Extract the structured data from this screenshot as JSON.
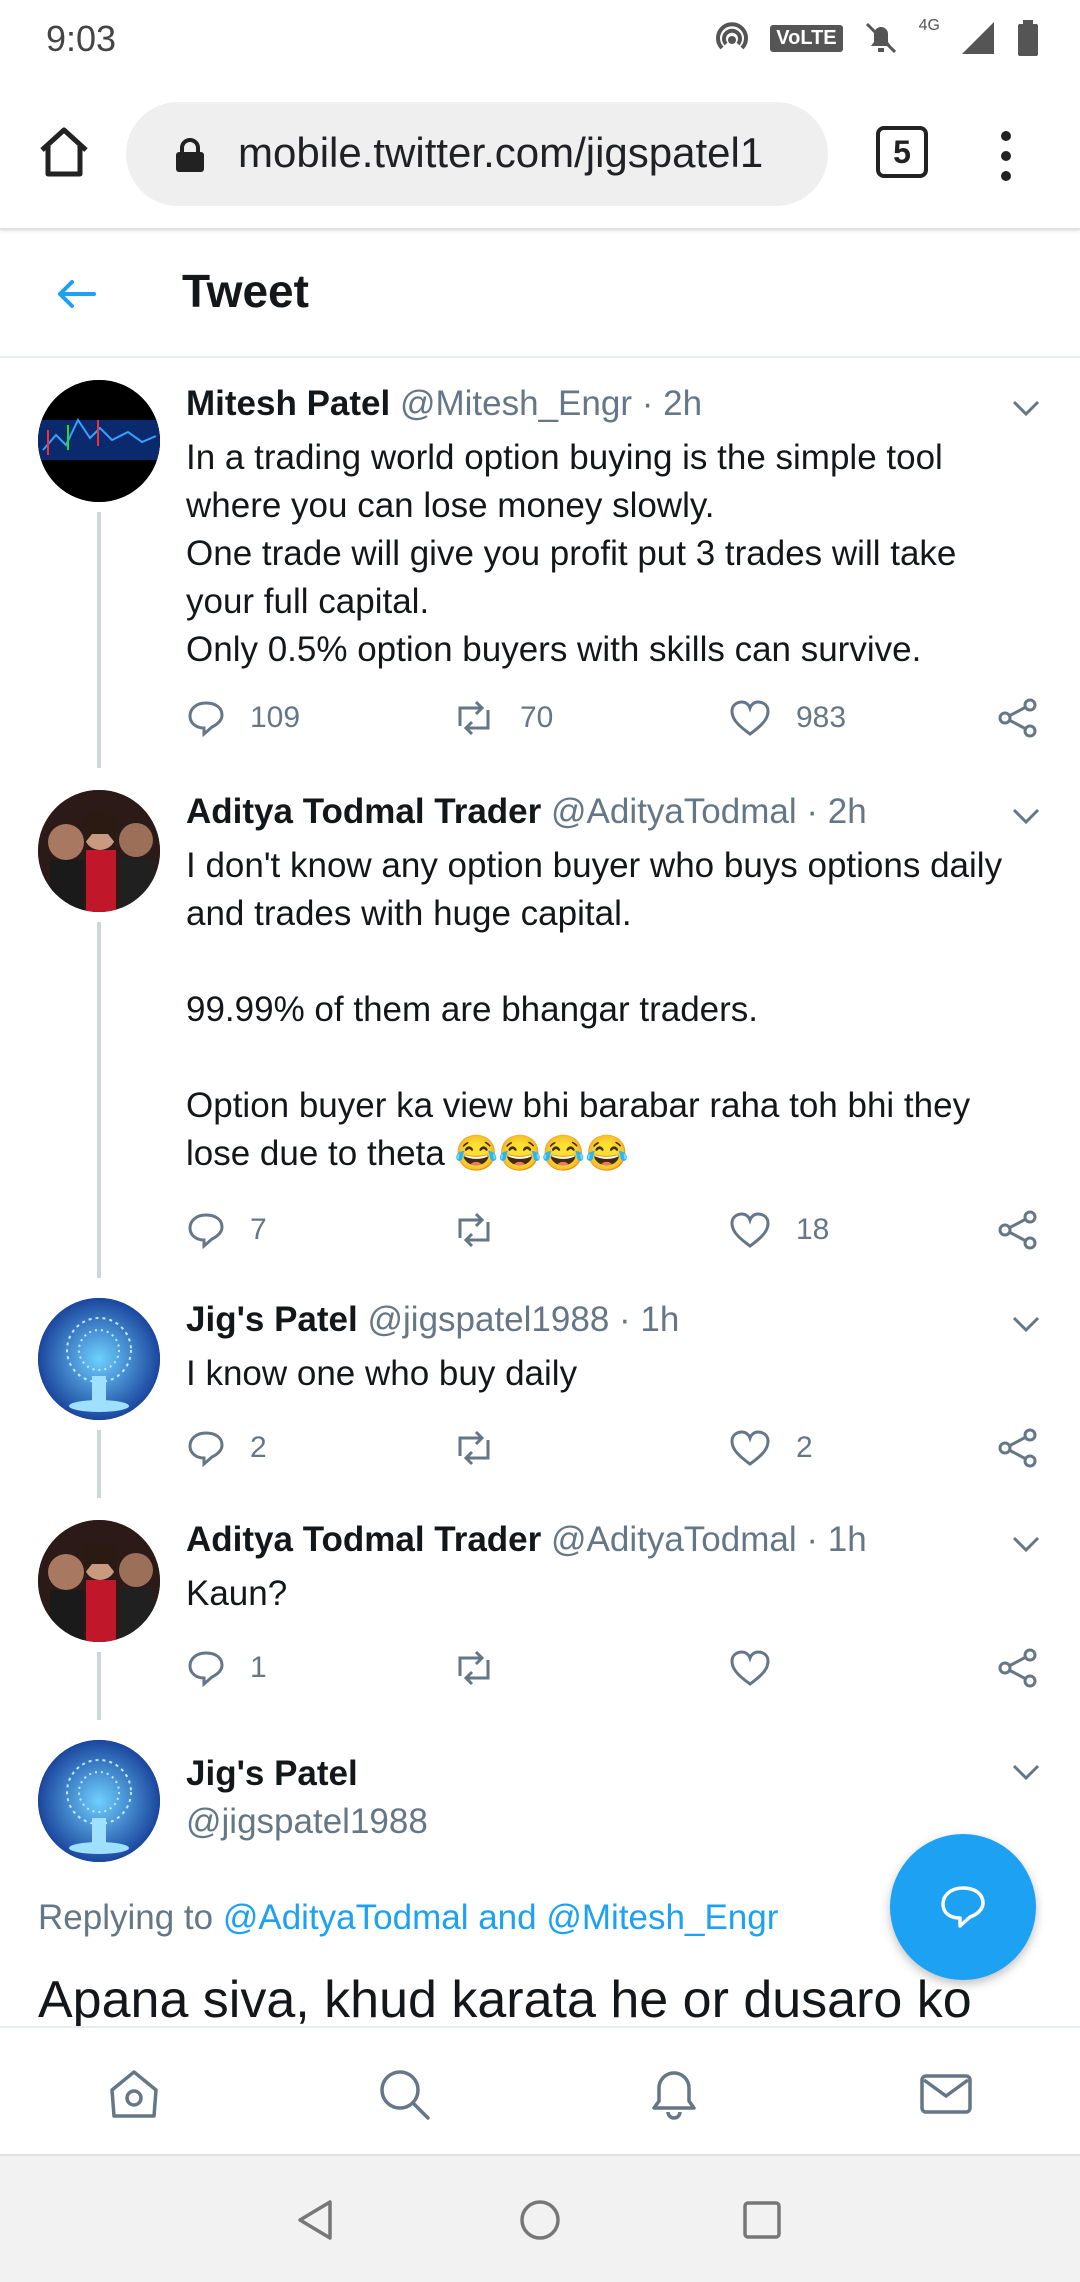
{
  "status_bar": {
    "time": "9:03",
    "network_label": "VoLTE",
    "signal_label": "4G"
  },
  "browser": {
    "url": "mobile.twitter.com/jigspatel1",
    "tab_count": "5"
  },
  "header": {
    "title": "Tweet"
  },
  "tweets": [
    {
      "name": "Mitesh Patel",
      "handle": "@Mitesh_Engr",
      "time": "2h",
      "text": "In a trading world option buying is the simple tool\nwhere you can lose money slowly.\nOne trade will give you profit put 3 trades will take\nyour full capital.\nOnly 0.5% option buyers with skills can survive.",
      "replies": "109",
      "retweets": "70",
      "likes": "983"
    },
    {
      "name": "Aditya Todmal Trader",
      "handle": "@AdityaTodmal",
      "time": "2h",
      "text": "I don't know any option buyer who buys options daily\nand trades with huge capital.\n\n99.99% of them are bhangar traders.\n\nOption buyer ka view bhi barabar raha toh bhi they\nlose due to theta 😂😂😂😂",
      "replies": "7",
      "retweets": "",
      "likes": "18"
    },
    {
      "name": "Jig's Patel",
      "handle": "@jigspatel1988",
      "time": "1h",
      "text": "I know one who buy daily",
      "replies": "2",
      "retweets": "",
      "likes": "2"
    },
    {
      "name": "Aditya Todmal Trader",
      "handle": "@AdityaTodmal",
      "time": "1h",
      "text": "Kaun?",
      "replies": "1",
      "retweets": "",
      "likes": ""
    }
  ],
  "focused_tweet": {
    "name": "Jig's Patel",
    "handle": "@jigspatel1988",
    "replying_prefix": "Replying to",
    "replying_to_1": "@AdityaTodmal",
    "replying_and": "and",
    "replying_to_2": "@Mitesh_Engr",
    "text": "Apana siva, khud karata he or dusaro ko"
  },
  "colors": {
    "accent": "#1da1f2",
    "muted": "#657786",
    "text": "#14171a"
  }
}
